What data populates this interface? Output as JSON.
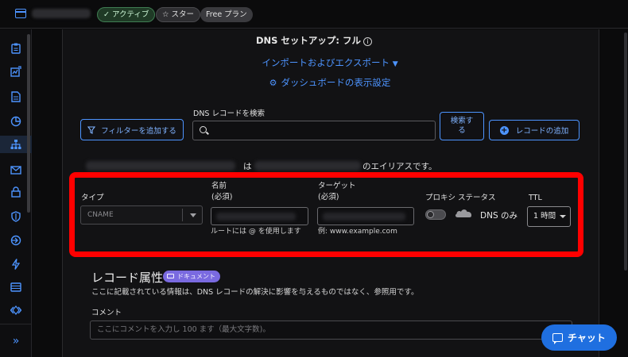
{
  "header": {
    "badges": [
      {
        "label": "✓ アクティブ"
      },
      {
        "label": "☆ スター"
      },
      {
        "label": "Free プラン"
      }
    ]
  },
  "sidebar": {
    "icons": [
      "clipboard-icon",
      "analytics-icon",
      "document-icon",
      "pie-chart-icon",
      "dns-network-icon",
      "email-icon",
      "lock-icon",
      "shield-icon",
      "route-icon",
      "lightning-icon",
      "storage-icon",
      "code-icon"
    ],
    "active_index": 4,
    "collapse_label": "»"
  },
  "main": {
    "dns_setup": "DNS セットアップ: フル",
    "import_export": "インポートおよびエクスポート",
    "dashboard_settings": "ダッシュボードの表示設定",
    "search_label": "DNS レコードを検索",
    "filter_button": "フィルターを追加する",
    "search_button": "検索する",
    "add_record_button": "レコードの追加",
    "alias_is": "は",
    "alias_suffix": "のエイリアスです。"
  },
  "record": {
    "type_label": "タイプ",
    "type_value": "CNAME",
    "name_label": "名前",
    "name_required": "(必須)",
    "name_helper": "ルートには @ を使用します",
    "target_label": "ターゲット",
    "target_required": "(必須)",
    "target_helper": "例: www.example.com",
    "proxy_label": "プロキシ ステータス",
    "proxy_value": "DNS のみ",
    "ttl_label": "TTL",
    "ttl_value": "1 時間"
  },
  "attributes": {
    "title": "レコード属性",
    "doc_badge": "ドキュメント",
    "description": "ここに記載されている情報は、DNS レコードの解決に影響を与えるものではなく、参照用です。",
    "comment_label": "コメント",
    "comment_placeholder": "ここにコメントを入力し 100 ます（最大文字数)。"
  },
  "chat": {
    "label": "チャット"
  },
  "colors": {
    "accent": "#4d94ff",
    "highlight": "#ff0000",
    "chat": "#1f6fe0",
    "badge": "#7a6ae0"
  }
}
